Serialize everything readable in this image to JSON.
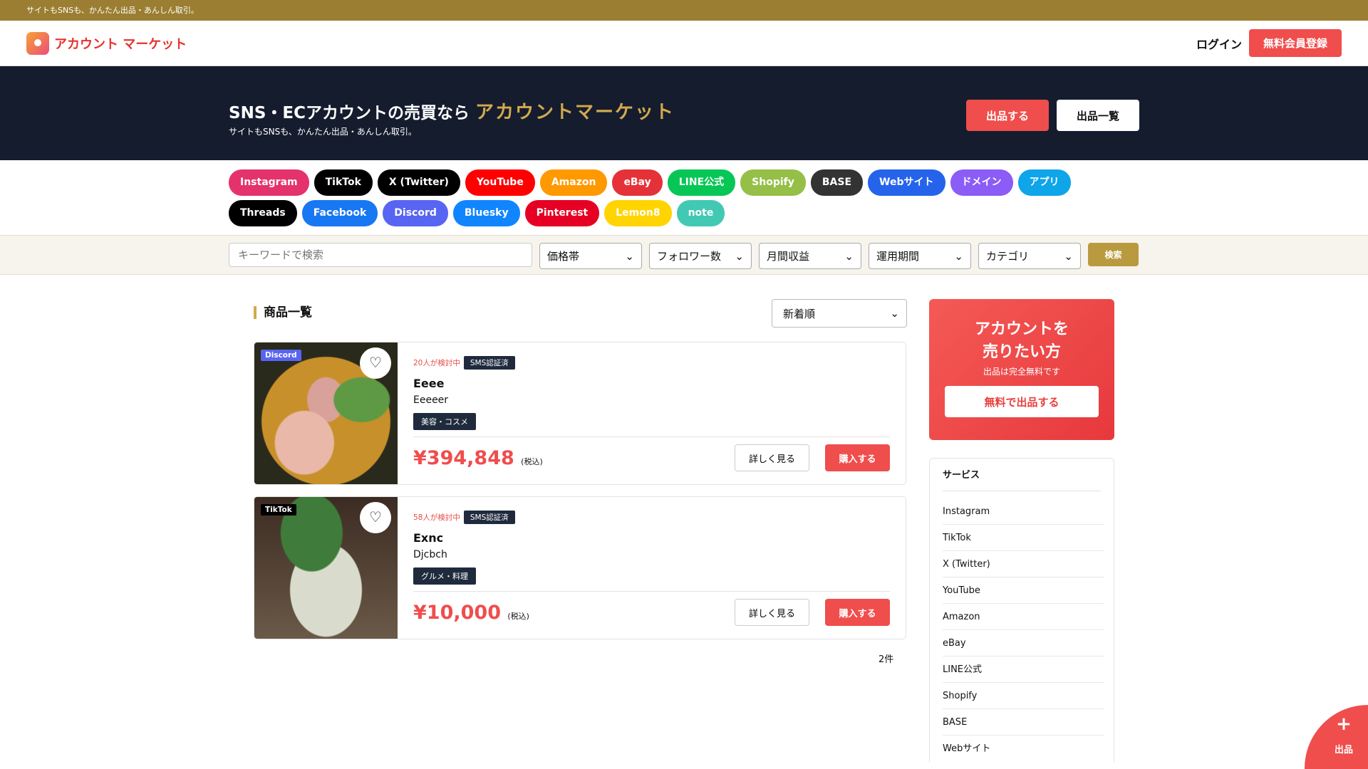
{
  "topbar": {
    "text": "サイトもSNSも、かんたん出品・あんしん取引。"
  },
  "header": {
    "logo": "アカウント マーケット",
    "login": "ログイン",
    "signup": "無料会員登録"
  },
  "hero": {
    "title": "SNS・ECアカウントの売買なら",
    "title_accent": "アカウントマーケット",
    "subtitle": "サイトもSNSも、かんたん出品・あんしん取引。",
    "sell": "出品する",
    "list": "出品一覧"
  },
  "platforms": [
    {
      "label": "Instagram",
      "color": "#e4326d"
    },
    {
      "label": "TikTok",
      "color": "#000000"
    },
    {
      "label": "X (Twitter)",
      "color": "#000000"
    },
    {
      "label": "YouTube",
      "color": "#ff0000"
    },
    {
      "label": "Amazon",
      "color": "#ff9900"
    },
    {
      "label": "eBay",
      "color": "#e53238"
    },
    {
      "label": "LINE公式",
      "color": "#06c755"
    },
    {
      "label": "Shopify",
      "color": "#95bf47"
    },
    {
      "label": "BASE",
      "color": "#333333"
    },
    {
      "label": "Webサイト",
      "color": "#2563eb"
    },
    {
      "label": "ドメイン",
      "color": "#8b5cf6"
    },
    {
      "label": "アプリ",
      "color": "#0ea5e9"
    },
    {
      "label": "Threads",
      "color": "#000000"
    },
    {
      "label": "Facebook",
      "color": "#1877f2"
    },
    {
      "label": "Discord",
      "color": "#5865f2"
    },
    {
      "label": "Bluesky",
      "color": "#1185fe"
    },
    {
      "label": "Pinterest",
      "color": "#e60023"
    },
    {
      "label": "Lemon8",
      "color": "#ffd400"
    },
    {
      "label": "note",
      "color": "#41c9b4"
    }
  ],
  "search": {
    "placeholder": "キーワードで検索",
    "filters": [
      "価格帯",
      "フォロワー数",
      "月間収益",
      "運用期間",
      "カテゴリ"
    ],
    "button": "検索"
  },
  "list": {
    "title": "商品一覧",
    "sort": "新着順",
    "count": "2件",
    "items": [
      {
        "platform": "Discord",
        "platform_color": "#5865f2",
        "watching": "20人が検討中",
        "verified": "SMS認証済",
        "title": "Eeee",
        "desc": "Eeeeer",
        "category": "美容・コスメ",
        "price": "¥394,848",
        "tax": "(税込)",
        "detail": "詳しく見る",
        "buy": "購入する"
      },
      {
        "platform": "TikTok",
        "platform_color": "#000000",
        "watching": "58人が検討中",
        "verified": "SMS認証済",
        "title": "Exnc",
        "desc": "Djcbch",
        "category": "グルメ・料理",
        "price": "¥10,000",
        "tax": "(税込)",
        "detail": "詳しく見る",
        "buy": "購入する"
      }
    ]
  },
  "sidebar": {
    "promo_title_1": "アカウントを",
    "promo_title_2": "売りたい方",
    "promo_sub": "出品は完全無料です",
    "promo_button": "無料で出品する",
    "services_title": "サービス",
    "services": [
      "Instagram",
      "TikTok",
      "X (Twitter)",
      "YouTube",
      "Amazon",
      "eBay",
      "LINE公式",
      "Shopify",
      "BASE",
      "Webサイト"
    ]
  },
  "fab": {
    "icon": "+",
    "label": "出品"
  }
}
